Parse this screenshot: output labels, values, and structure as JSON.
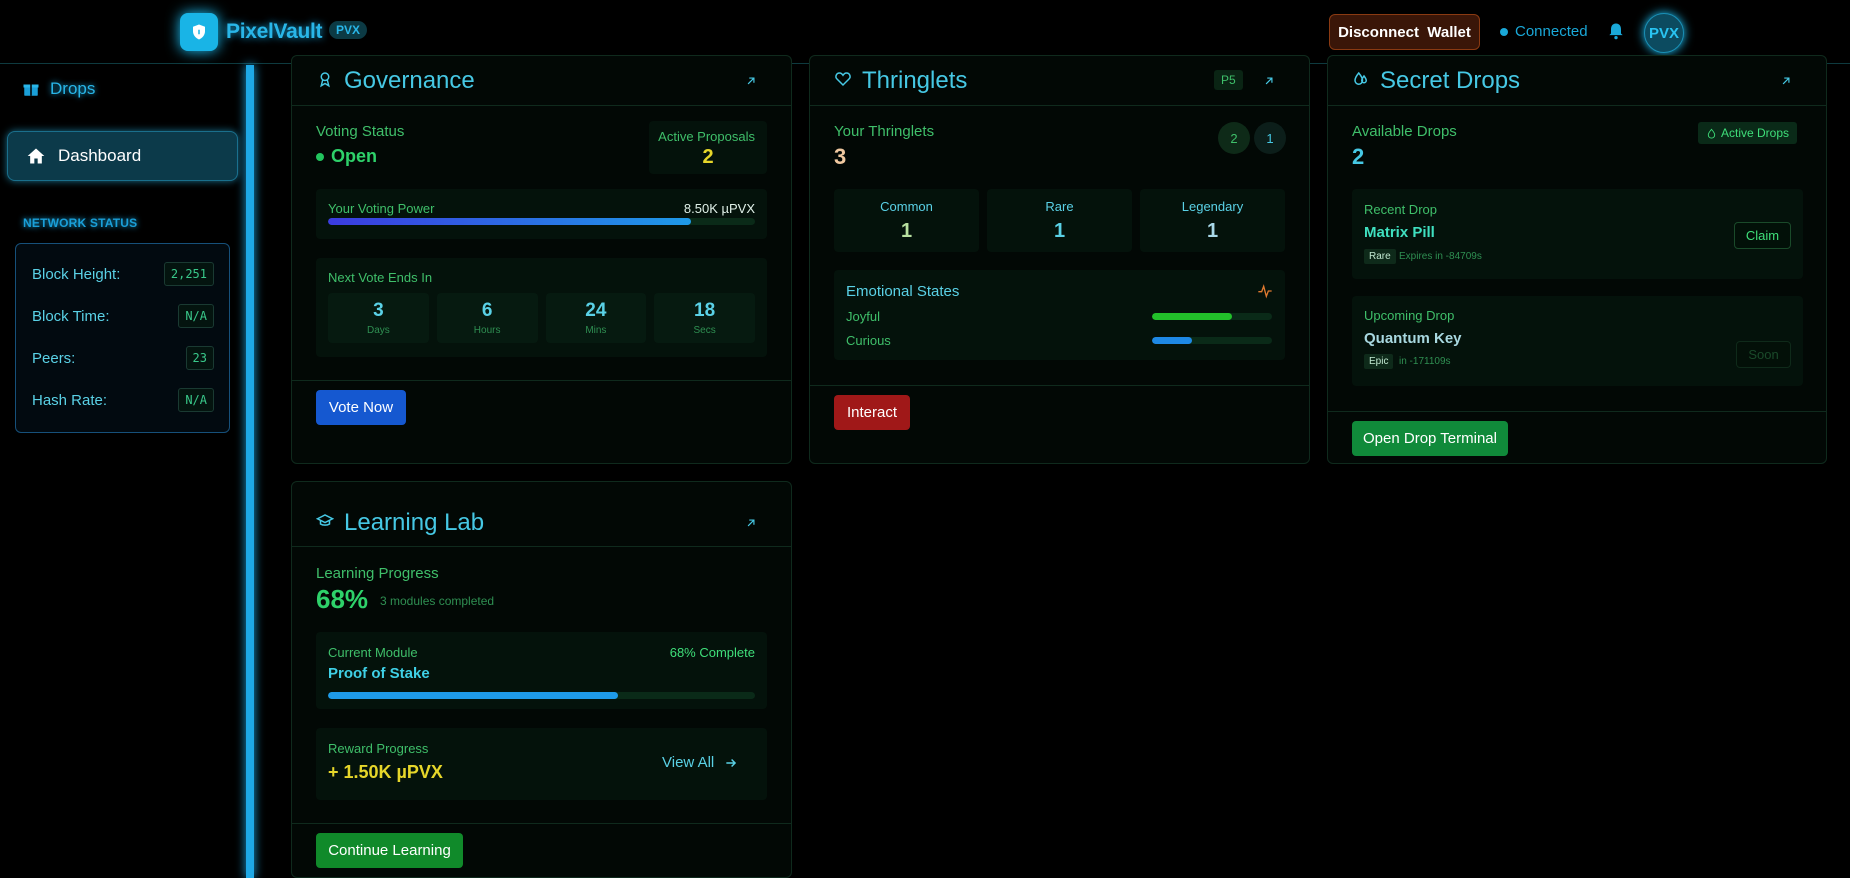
{
  "header": {
    "brand": "PixelVault",
    "badge": "PVX",
    "disconnect_label": "Disconnect  Wallet",
    "status": "Connected",
    "avatar": "PVX"
  },
  "sidebar": {
    "items": [
      {
        "label": "Drops",
        "icon": "gift-icon"
      },
      {
        "label": "Dashboard",
        "icon": "home-icon",
        "active": true
      }
    ],
    "network_title": "NETWORK STATUS",
    "network": [
      {
        "key": "Block Height:",
        "value": "2,251"
      },
      {
        "key": "Block Time:",
        "value": "N/A"
      },
      {
        "key": "Peers:",
        "value": "23"
      },
      {
        "key": "Hash Rate:",
        "value": "N/A"
      }
    ]
  },
  "governance": {
    "title": "Governance",
    "voting_status_label": "Voting Status",
    "voting_status": "Open",
    "active_proposals_label": "Active Proposals",
    "active_proposals": "2",
    "voting_power_label": "Your Voting Power",
    "voting_power": "8.50K µPVX",
    "voting_power_fraction": 0.85,
    "next_vote_label": "Next Vote Ends In",
    "countdown": [
      {
        "value": "3",
        "unit": "Days"
      },
      {
        "value": "6",
        "unit": "Hours"
      },
      {
        "value": "24",
        "unit": "Mins"
      },
      {
        "value": "18",
        "unit": "Secs"
      }
    ],
    "vote_button": "Vote Now"
  },
  "thringlets": {
    "title": "Thringlets",
    "badge": "P5",
    "your_label": "Your Thringlets",
    "count": "3",
    "chips": [
      "2",
      "1"
    ],
    "rarities": [
      {
        "label": "Common",
        "value": "1"
      },
      {
        "label": "Rare",
        "value": "1"
      },
      {
        "label": "Legendary",
        "value": "1"
      }
    ],
    "emotional_label": "Emotional States",
    "emotions": [
      {
        "label": "Joyful",
        "fraction": 0.67,
        "color": "#22c02a"
      },
      {
        "label": "Curious",
        "fraction": 0.33,
        "color": "#1e88e5"
      }
    ],
    "interact_button": "Interact"
  },
  "secret_drops": {
    "title": "Secret Drops",
    "available_label": "Available Drops",
    "available": "2",
    "active_badge": "Active Drops",
    "recent_label": "Recent Drop",
    "recent_name": "Matrix Pill",
    "recent_tag": "Rare",
    "recent_expiry": "Expires in -84709s",
    "claim_button": "Claim",
    "upcoming_label": "Upcoming Drop",
    "upcoming_name": "Quantum Key",
    "upcoming_tag": "Epic",
    "upcoming_time": "in -171109s",
    "soon_button": "Soon",
    "terminal_button": "Open Drop Terminal"
  },
  "learning": {
    "title": "Learning Lab",
    "progress_label": "Learning Progress",
    "progress": "68%",
    "modules": "3 modules completed",
    "current_label": "Current Module",
    "complete": "68% Complete",
    "module_name": "Proof of Stake",
    "module_fraction": 0.68,
    "reward_label": "Reward Progress",
    "reward": "+ 1.50K µPVX",
    "view_all": "View All",
    "continue_button": "Continue Learning"
  },
  "colors": {
    "accent": "#29b6e8",
    "green": "#3fbf6a",
    "yellow": "#e6d62a"
  }
}
